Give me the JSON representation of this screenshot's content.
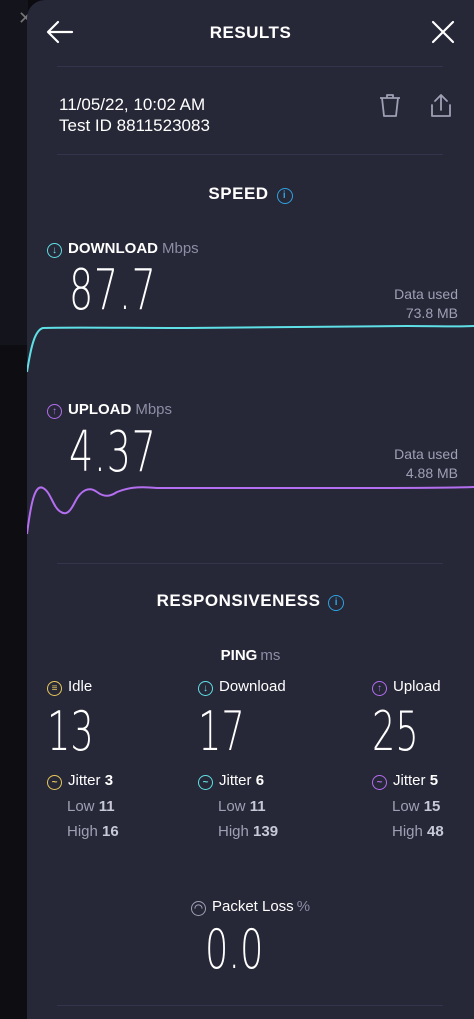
{
  "header": {
    "title": "RESULTS"
  },
  "meta": {
    "datetime": "11/05/22, 10:02 AM",
    "test_id": "Test ID 8811523083"
  },
  "speed": {
    "title": "SPEED",
    "download": {
      "label": "DOWNLOAD",
      "unit": "Mbps",
      "value": "87.7",
      "data_used_label": "Data used",
      "data_used_value": "73.8 MB"
    },
    "upload": {
      "label": "UPLOAD",
      "unit": "Mbps",
      "value": "4.37",
      "data_used_label": "Data used",
      "data_used_value": "4.88 MB"
    }
  },
  "responsiveness": {
    "title": "RESPONSIVENESS",
    "ping_label": "PING",
    "ping_unit": "ms",
    "idle": {
      "label": "Idle",
      "value": "13",
      "jitter_label": "Jitter",
      "jitter": "3",
      "low_label": "Low",
      "low": "11",
      "high_label": "High",
      "high": "16"
    },
    "download": {
      "label": "Download",
      "value": "17",
      "jitter_label": "Jitter",
      "jitter": "6",
      "low_label": "Low",
      "low": "11",
      "high_label": "High",
      "high": "139"
    },
    "upload": {
      "label": "Upload",
      "value": "25",
      "jitter_label": "Jitter",
      "jitter": "5",
      "low_label": "Low",
      "low": "15",
      "high_label": "High",
      "high": "48"
    }
  },
  "packet_loss": {
    "label": "Packet Loss",
    "unit": "%",
    "value": "0.0"
  },
  "colors": {
    "background": "#262737",
    "download_accent": "#5fe0e6",
    "upload_accent": "#b46ef0",
    "idle_accent": "#e8c85a",
    "info_accent": "#2ea3e0"
  },
  "icons": [
    "back-arrow-icon",
    "close-icon",
    "trash-icon",
    "share-icon",
    "info-icon",
    "download-arrow-icon",
    "upload-arrow-icon",
    "idle-icon",
    "jitter-icon",
    "packet-loss-icon"
  ]
}
